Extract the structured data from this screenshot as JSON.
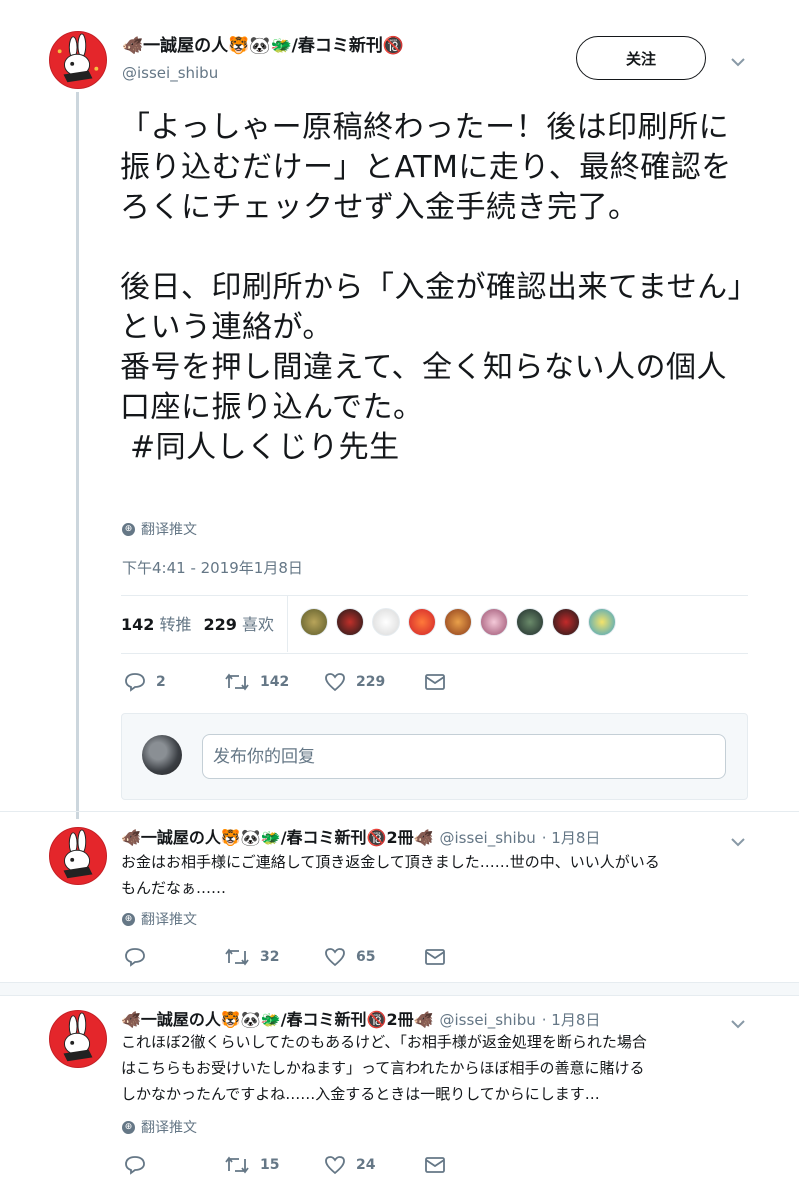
{
  "main_tweet": {
    "display_name": "🐗一誠屋の人🐯🐼🐲/春コミ新刊🔞",
    "handle": "@issei_shibu",
    "follow_label": "关注",
    "text": "「よっしゃー原稿終わったー！後は印刷所に振り込むだけー」とATMに走り、最終確認をろくにチェックせず入金手続き完了。\n\n後日、印刷所から「入金が確認出来てません」という連絡が。\n番号を押し間違えて、全く知らない人の個人口座に振り込んでた。\n #同人しくじり先生",
    "translate_label": "翻译推文",
    "timestamp": "下午4:41 - 2019年1月8日",
    "retweets_count": "142",
    "retweets_label": "转推",
    "likes_count": "229",
    "likes_label": "喜欢",
    "actions": {
      "replies": "2",
      "retweets": "142",
      "likes": "229"
    }
  },
  "reply_composer": {
    "placeholder": "发布你的回复"
  },
  "thread_tweets": [
    {
      "display_name": "🐗一誠屋の人🐯🐼🐲/春コミ新刊🔞2冊🐗",
      "handle": "@issei_shibu",
      "date": "· 1月8日",
      "line1": "お金はお相手様にご連絡して頂き返金して頂きました……世の中、いい人がいる",
      "line2": "もんだなぁ……",
      "translate_label": "翻译推文",
      "actions": {
        "replies": "",
        "retweets": "32",
        "likes": "65"
      }
    },
    {
      "display_name": "🐗一誠屋の人🐯🐼🐲/春コミ新刊🔞2冊🐗",
      "handle": "@issei_shibu",
      "date": "· 1月8日",
      "line1": "これほぼ2徹くらいしてたのもあるけど、「お相手様が返金処理を断られた場合",
      "line2": "はこちらもお受けいたしかねます」って言われたからほぼ相手の善意に賭ける",
      "line3": "しかなかったんですよね……入金するときは一眠りしてからにします…",
      "translate_label": "翻译推文",
      "actions": {
        "replies": "",
        "retweets": "15",
        "likes": "24"
      }
    }
  ],
  "colors": {
    "text": "#14171a",
    "secondary": "#657786",
    "divider": "#e6ecf0",
    "avatar_red": "#e4262b"
  }
}
